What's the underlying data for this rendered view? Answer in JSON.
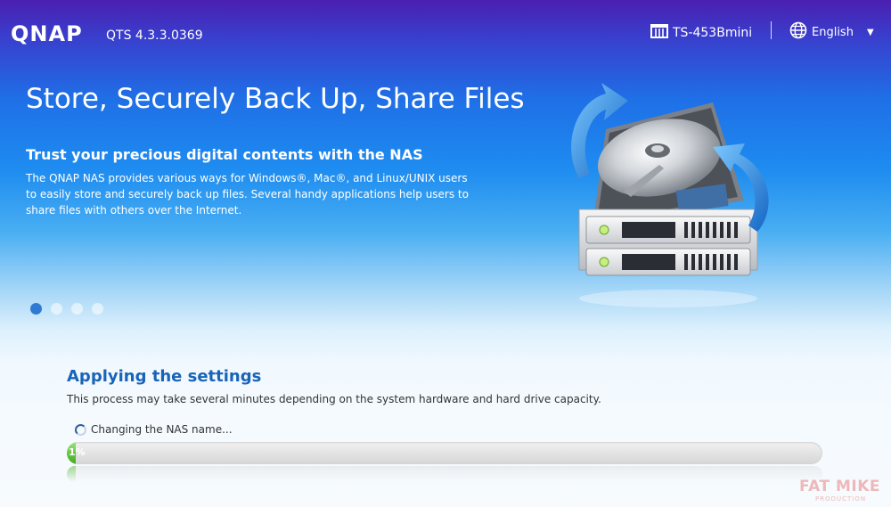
{
  "header": {
    "logo": "QNAP",
    "version": "QTS 4.3.3.0369",
    "model": "TS-453Bmini",
    "language": "English"
  },
  "hero": {
    "title": "Store, Securely Back Up, Share Files",
    "subtitle": "Trust your precious digital contents with the NAS",
    "description": "The QNAP NAS provides various ways for Windows®, Mac®, and Linux/UNIX users to easily store and securely back up files. Several handy applications help users to share files with others over the Internet.",
    "slides": 4,
    "active_slide": 1
  },
  "setup": {
    "title": "Applying the settings",
    "description": "This process may take several minutes depending on the system hardware and hard drive capacity.",
    "status": "Changing the NAS name...",
    "progress_percent": 1,
    "progress_label": "1%"
  },
  "watermark": {
    "text": "FAT MIKE",
    "subtext": "PRODUCTION"
  },
  "colors": {
    "accent_title": "#1864b8",
    "progress_green": "#5fc13c",
    "active_dot": "#2f7bd4"
  },
  "icons": [
    "server-icon",
    "globe-icon",
    "chevron-down-icon",
    "spinner-icon",
    "nas-illustration"
  ]
}
